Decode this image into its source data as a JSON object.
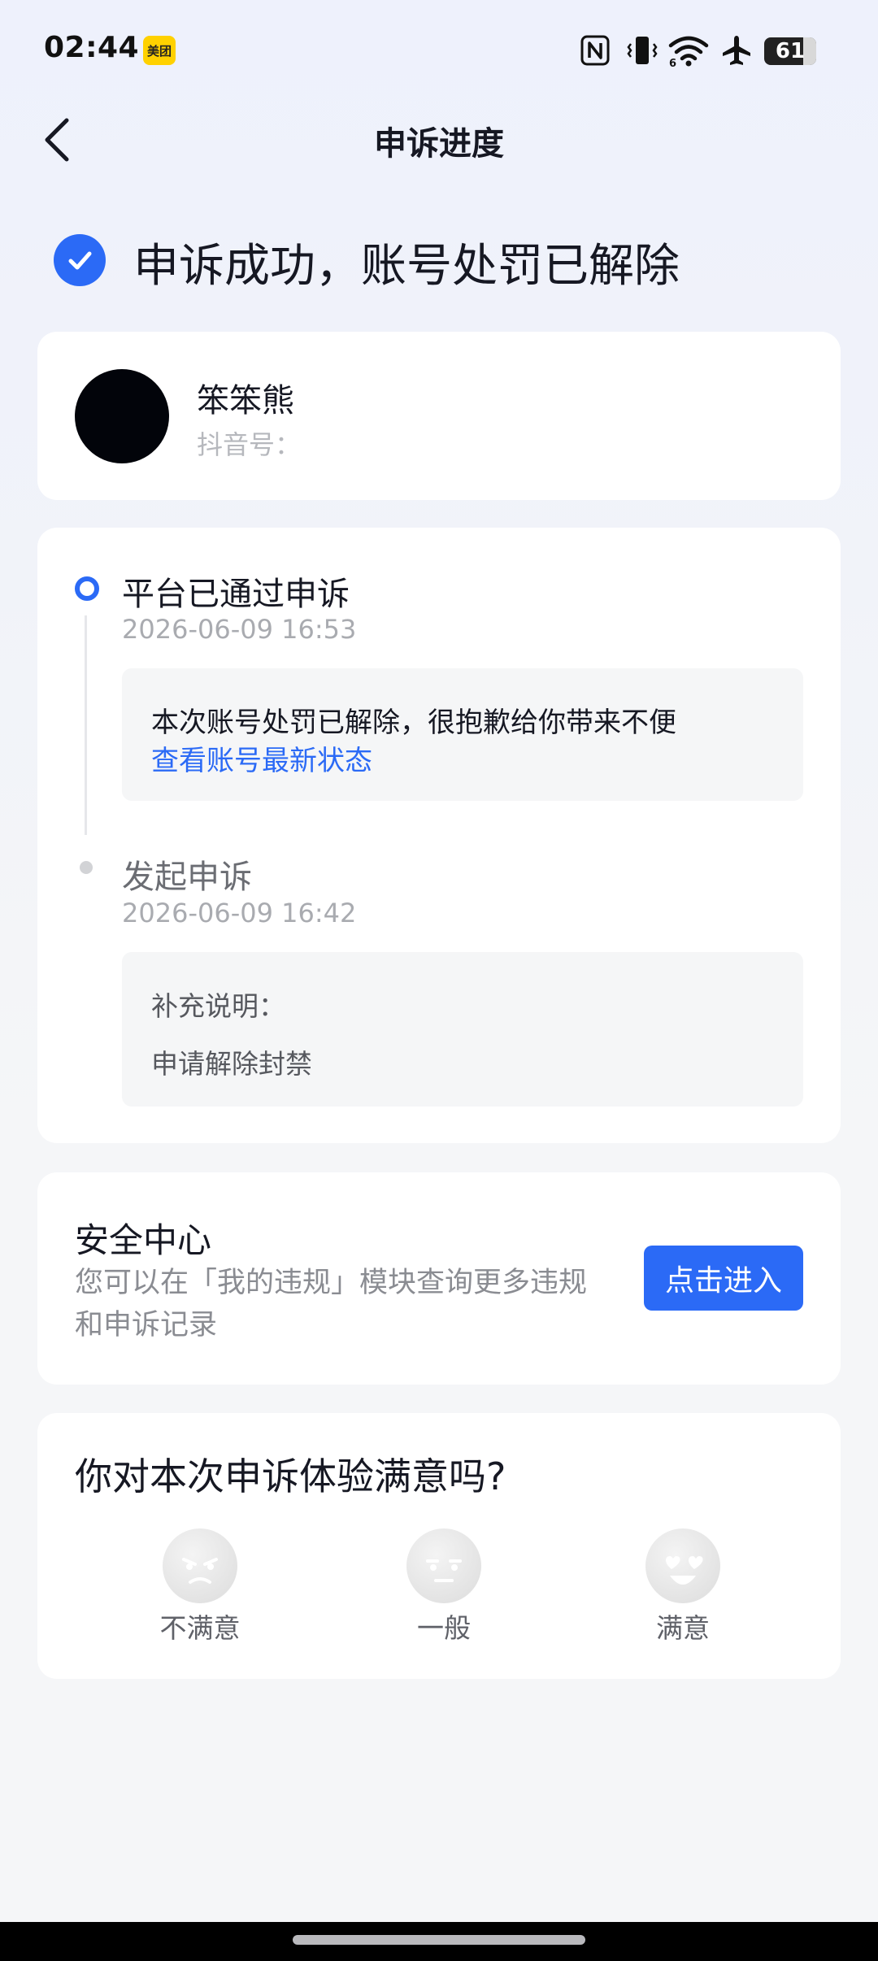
{
  "status_bar": {
    "time": "02:44",
    "app_badge": "美团",
    "icons": [
      "nfc-icon",
      "vibrate-icon",
      "wifi-icon",
      "airplane-icon"
    ],
    "battery": "61"
  },
  "nav": {
    "title": "申诉进度",
    "back_icon": "chevron-left-icon"
  },
  "result": {
    "text": "申诉成功，账号处罚已解除",
    "icon": "check-circle-icon"
  },
  "user": {
    "name": "笨笨熊",
    "id_label": "抖音号："
  },
  "timeline": {
    "steps": [
      {
        "title": "平台已通过申诉",
        "time": "2026-06-09 16:53",
        "message": "本次账号处罚已解除，很抱歉给你带来不便",
        "link": "查看账号最新状态"
      },
      {
        "title": "发起申诉",
        "time": "2026-06-09 16:42",
        "label": "补充说明：",
        "content": "申请解除封禁"
      }
    ]
  },
  "security": {
    "title": "安全中心",
    "description": "您可以在「我的违规」模块查询更多违规和申诉记录",
    "button": "点击进入"
  },
  "rating": {
    "question": "你对本次申诉体验满意吗?",
    "options": [
      {
        "label": "不满意",
        "icon": "angry-face-icon"
      },
      {
        "label": "一般",
        "icon": "neutral-face-icon"
      },
      {
        "label": "满意",
        "icon": "heart-eyes-face-icon"
      }
    ]
  },
  "colors": {
    "accent": "#2b6af6",
    "text_primary": "#161823",
    "text_secondary": "#a9abb0"
  }
}
